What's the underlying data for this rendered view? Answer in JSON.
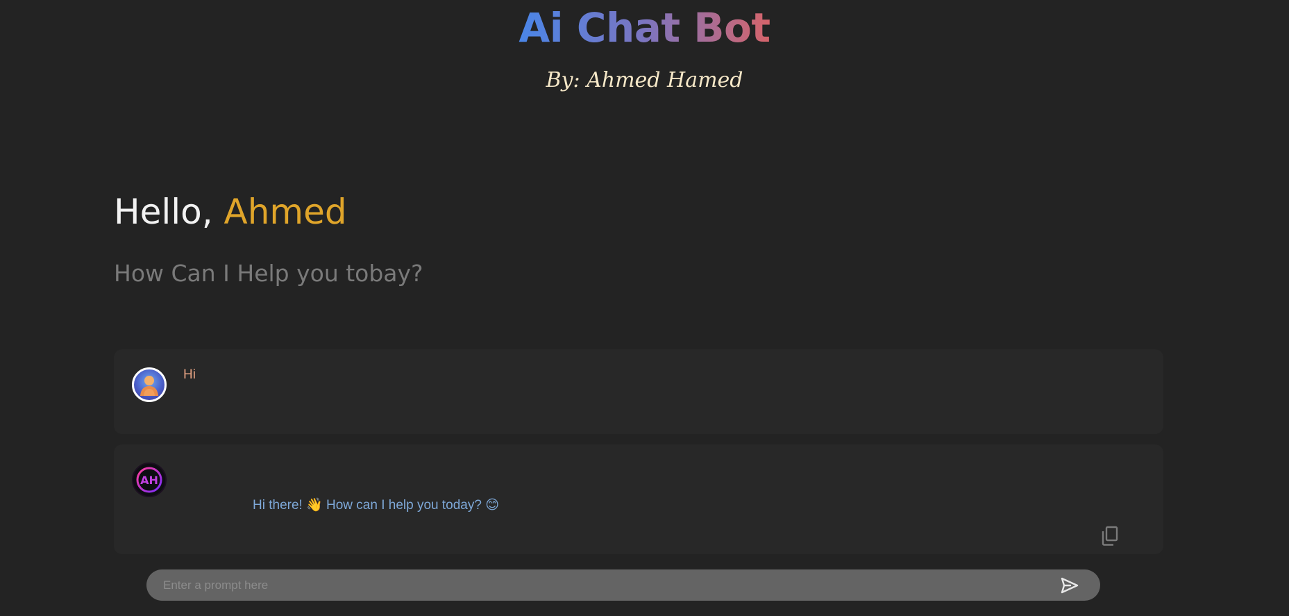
{
  "header": {
    "title": "Ai Chat Bot",
    "author": "By: Ahmed Hamed"
  },
  "greeting": {
    "hello": "Hello, ",
    "name": "Ahmed",
    "subtitle": "How Can I Help you tobay?"
  },
  "messages": [
    {
      "role": "user",
      "avatar_icon": "user-avatar-icon",
      "text": "Hi"
    },
    {
      "role": "bot",
      "avatar_icon": "ah-logo-icon",
      "avatar_text": "AH",
      "text": "Hi there! 👋 How can I help you today? 😊",
      "action_icon": "copy-icon"
    }
  ],
  "prompt": {
    "placeholder": "Enter a prompt here",
    "send_icon": "send-icon"
  },
  "colors": {
    "background": "#232323",
    "card": "#282828",
    "accent_name": "#e0a52a",
    "user_text": "#e6a383",
    "bot_text": "#7ea8d8",
    "title_gradient_start": "#4a86e8",
    "title_gradient_end": "#d6646a"
  }
}
